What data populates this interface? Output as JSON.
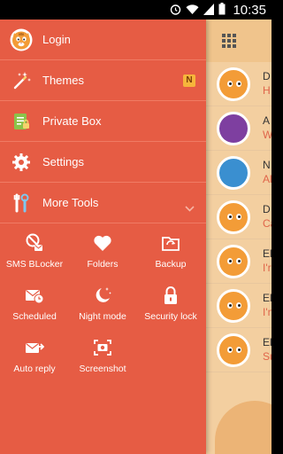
{
  "status_bar": {
    "time": "10:35"
  },
  "drawer": {
    "menu": [
      {
        "label": "Login",
        "icon": "tiger-avatar-icon"
      },
      {
        "label": "Themes",
        "icon": "magic-wand-icon",
        "badge": "N"
      },
      {
        "label": "Private Box",
        "icon": "private-box-icon"
      },
      {
        "label": "Settings",
        "icon": "gear-icon"
      },
      {
        "label": "More Tools",
        "icon": "tools-icon"
      }
    ],
    "tools": [
      {
        "label": "SMS BLocker",
        "icon": "sms-blocker-icon"
      },
      {
        "label": "Folders",
        "icon": "heart-icon"
      },
      {
        "label": "Backup",
        "icon": "backup-folder-icon"
      },
      {
        "label": "Scheduled",
        "icon": "scheduled-mail-icon"
      },
      {
        "label": "Night mode",
        "icon": "night-mode-icon"
      },
      {
        "label": "Security lock",
        "icon": "lock-icon"
      },
      {
        "label": "Auto reply",
        "icon": "auto-reply-icon"
      },
      {
        "label": "Screenshot",
        "icon": "screenshot-icon"
      }
    ]
  },
  "conversations": [
    {
      "name": "D",
      "snippet": "H"
    },
    {
      "name": "A",
      "snippet": "W"
    },
    {
      "name": "N",
      "snippet": "Al"
    },
    {
      "name": "D",
      "snippet": "Ca"
    },
    {
      "name": "El",
      "snippet": "I'r"
    },
    {
      "name": "El",
      "snippet": "I'n"
    },
    {
      "name": "El",
      "snippet": "Su"
    }
  ],
  "colors": {
    "drawer_bg": "#e65c44",
    "divider": "#f07b64",
    "badge": "#f6b53b",
    "snippet": "#e0654a"
  }
}
